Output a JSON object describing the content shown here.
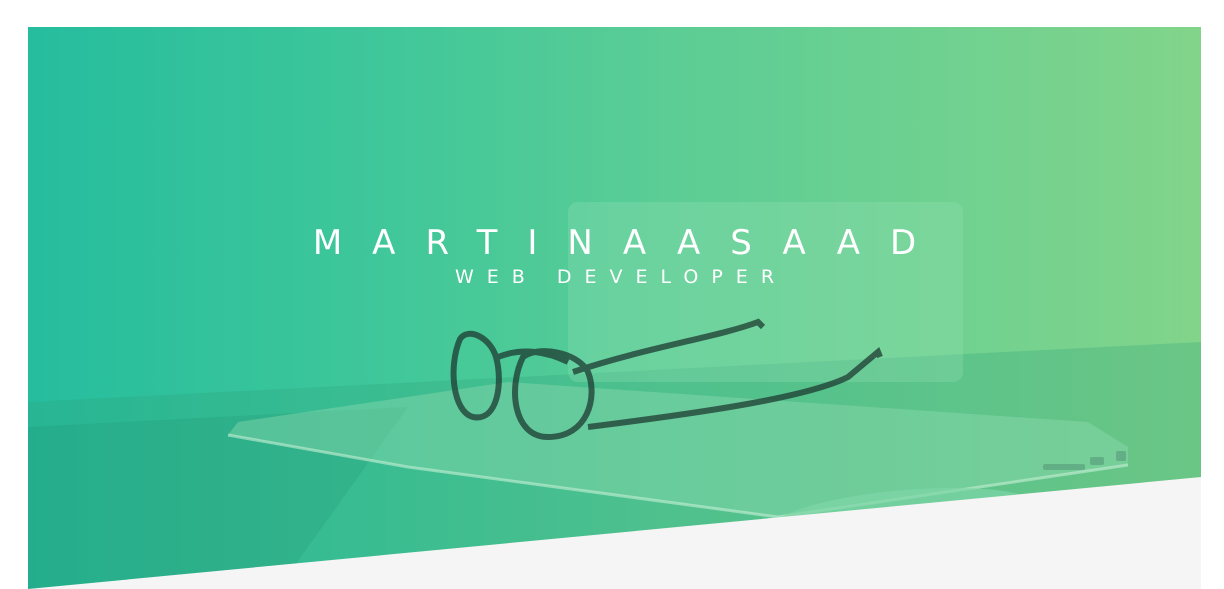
{
  "hero": {
    "name": "MARTINAASAAD",
    "role": "WEB DEVELOPER",
    "background_image": "glasses-on-laptop-photo",
    "gradient": {
      "start": "#25bd9e",
      "end": "#82d48a"
    }
  },
  "colors": {
    "page_background": "#ffffff",
    "lower_section": "#f5f5f5",
    "text": "#ffffff"
  }
}
